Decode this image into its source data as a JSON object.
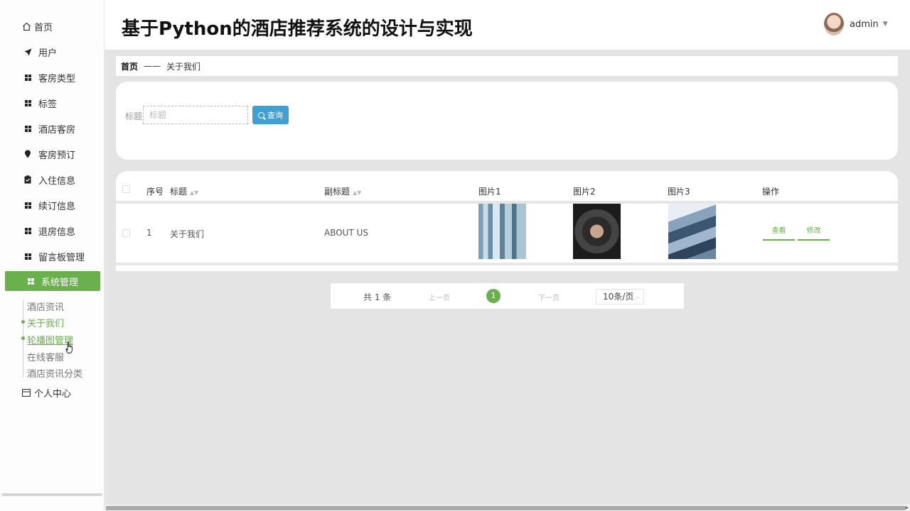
{
  "sidebar": {
    "home_label": "首页",
    "items": [
      {
        "label": "用户",
        "icon": "send-icon"
      },
      {
        "label": "客房类型",
        "icon": "grid-icon"
      },
      {
        "label": "标签",
        "icon": "grid-icon"
      },
      {
        "label": "酒店客房",
        "icon": "grid-icon"
      },
      {
        "label": "客房预订",
        "icon": "pin-icon"
      },
      {
        "label": "入住信息",
        "icon": "clipboard-icon"
      },
      {
        "label": "续订信息",
        "icon": "grid-icon"
      },
      {
        "label": "退房信息",
        "icon": "grid-icon"
      },
      {
        "label": "留言板管理",
        "icon": "grid-icon"
      },
      {
        "label": "系统管理",
        "icon": "grid-icon",
        "active": true
      }
    ],
    "submenu": [
      "酒店资讯",
      "关于我们",
      "轮播图管理",
      "在线客服",
      "酒店资讯分类"
    ],
    "personal_label": "个人中心",
    "accent_color": "#6ab04c"
  },
  "header": {
    "title": "基于Python的酒店推荐系统的设计与实现",
    "username": "admin"
  },
  "breadcrumb": {
    "home": "首页",
    "separator": "——",
    "current": "关于我们"
  },
  "search": {
    "label": "标题",
    "placeholder": "标题",
    "button_label": "查询",
    "button_color": "#3ea1d2"
  },
  "table": {
    "headers": {
      "index": "序号",
      "title": "标题",
      "subtitle": "副标题",
      "image1": "图片1",
      "image2": "图片2",
      "image3": "图片3",
      "actions": "操作"
    },
    "rows": [
      {
        "index": "1",
        "title": "关于我们",
        "subtitle": "ABOUT US",
        "view_label": "查看",
        "edit_label": "修改"
      }
    ]
  },
  "pagination": {
    "total": "共 1 条",
    "prev": "上一页",
    "current": "1",
    "next": "下一页",
    "page_size": "10条/页"
  }
}
